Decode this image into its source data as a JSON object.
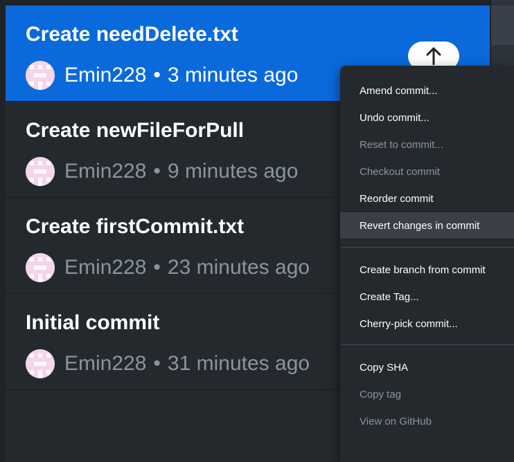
{
  "commits": [
    {
      "title": "Create needDelete.txt",
      "author": "Emin228",
      "separator": "•",
      "time": "3 minutes ago"
    },
    {
      "title": "Create newFileForPull",
      "author": "Emin228",
      "separator": "•",
      "time": "9 minutes ago"
    },
    {
      "title": "Create firstCommit.txt",
      "author": "Emin228",
      "separator": "•",
      "time": "23 minutes ago"
    },
    {
      "title": "Initial commit",
      "author": "Emin228",
      "separator": "•",
      "time": "31 minutes ago"
    }
  ],
  "push_badge_icon": "arrow-up-icon",
  "context_menu": {
    "amend": "Amend commit...",
    "undo": "Undo commit...",
    "reset": "Reset to commit...",
    "checkout": "Checkout commit",
    "reorder": "Reorder commit",
    "revert": "Revert changes in commit",
    "create_branch": "Create branch from commit",
    "create_tag": "Create Tag...",
    "cherry_pick": "Cherry-pick commit...",
    "copy_sha": "Copy SHA",
    "copy_tag": "Copy tag",
    "view_github": "View on GitHub"
  },
  "colors": {
    "selected_row": "#0a6adc",
    "background": "#24292e",
    "menu_hover": "#3b4048",
    "disabled_text": "#8b949e",
    "avatar": "#f6d4eb"
  }
}
